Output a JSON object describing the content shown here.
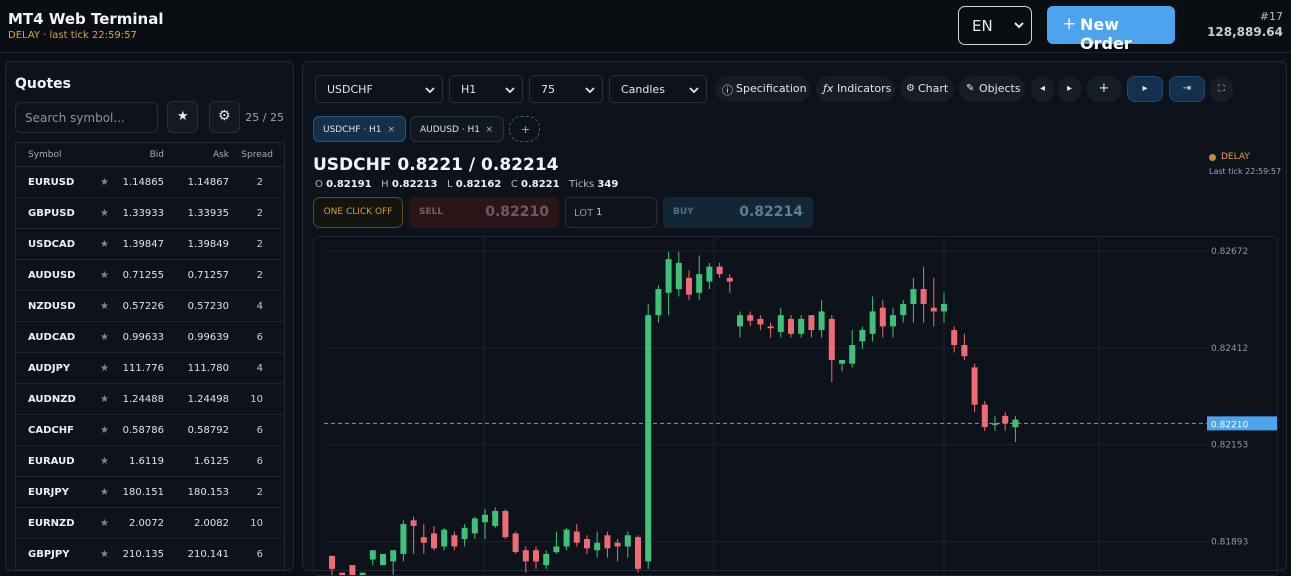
{
  "header": {
    "title": "MT4 Web Terminal",
    "subtitle": "DELAY · last tick 22:59:57",
    "language": "EN",
    "new_order_plus": "+",
    "new_order_label": "New Order",
    "account_id": "#17",
    "account_balance": "128,889.64"
  },
  "quotes": {
    "title": "Quotes",
    "search_placeholder": "Search symbol...",
    "star_glyph": "★",
    "gear_glyph": "⚙",
    "count": "25 / 25",
    "columns": {
      "symbol": "Symbol",
      "bid": "Bid",
      "ask": "Ask",
      "spread": "Spread"
    },
    "rows": [
      {
        "symbol": "EURUSD",
        "bid": "1.14865",
        "ask": "1.14867",
        "spread": "2"
      },
      {
        "symbol": "GBPUSD",
        "bid": "1.33933",
        "ask": "1.33935",
        "spread": "2"
      },
      {
        "symbol": "USDCAD",
        "bid": "1.39847",
        "ask": "1.39849",
        "spread": "2"
      },
      {
        "symbol": "AUDUSD",
        "bid": "0.71255",
        "ask": "0.71257",
        "spread": "2"
      },
      {
        "symbol": "NZDUSD",
        "bid": "0.57226",
        "ask": "0.57230",
        "spread": "4"
      },
      {
        "symbol": "AUDCAD",
        "bid": "0.99633",
        "ask": "0.99639",
        "spread": "6"
      },
      {
        "symbol": "AUDJPY",
        "bid": "111.776",
        "ask": "111.780",
        "spread": "4"
      },
      {
        "symbol": "AUDNZD",
        "bid": "1.24488",
        "ask": "1.24498",
        "spread": "10"
      },
      {
        "symbol": "CADCHF",
        "bid": "0.58786",
        "ask": "0.58792",
        "spread": "6"
      },
      {
        "symbol": "EURAUD",
        "bid": "1.6119",
        "ask": "1.6125",
        "spread": "6"
      },
      {
        "symbol": "EURJPY",
        "bid": "180.151",
        "ask": "180.153",
        "spread": "2"
      },
      {
        "symbol": "EURNZD",
        "bid": "2.0072",
        "ask": "2.0082",
        "spread": "10"
      },
      {
        "symbol": "GBPJPY",
        "bid": "210.135",
        "ask": "210.141",
        "spread": "6"
      }
    ]
  },
  "toolbar": {
    "symbol_select": "USDCHF",
    "timeframe_select": "H1",
    "bars_select": "75",
    "chart_type_select": "Candles",
    "specification": "Specification",
    "indicators": "Indicators",
    "chart": "Chart",
    "objects": "Objects",
    "spec_icon": "ⓘ",
    "ind_icon": "ƒx",
    "chart_icon": "⚙",
    "obj_icon": "✎",
    "prev_glyph": "◂",
    "next_glyph": "▸",
    "crosshair_glyph": "+",
    "play_glyph": "▸",
    "end_glyph": "⇥",
    "fullscreen_glyph": "⛶"
  },
  "tabs": [
    {
      "label": "USDCHF · H1",
      "active": true
    },
    {
      "label": "AUDUSD · H1",
      "active": false
    }
  ],
  "tab_close_glyph": "×",
  "add_tab_glyph": "+",
  "instrument": {
    "heading": "USDCHF 0.8221 / 0.82214",
    "open_label": "O",
    "open": "0.82191",
    "high_label": "H",
    "high": "0.82213",
    "low_label": "L",
    "low": "0.82162",
    "close_label": "C",
    "close": "0.8221",
    "ticks_label": "Ticks",
    "ticks": "349",
    "status": "DELAY",
    "last_tick": "Last tick 22:59:57"
  },
  "trade": {
    "one_click": "ONE CLICK OFF",
    "sell_label": "SELL",
    "sell_price": "0.82210",
    "lot_label": "LOT",
    "lot_value": "1",
    "buy_label": "BUY",
    "buy_price": "0.82214"
  },
  "colors": {
    "up": "#3ec27a",
    "down": "#ef6b73",
    "accent": "#4ea3ee",
    "delay": "#e3a04b"
  },
  "chart_data": {
    "type": "candlestick",
    "y_ticks": [
      "0.82672",
      "0.82412",
      "0.82153",
      "0.81893"
    ],
    "y_tick_values": [
      0.82672,
      0.82412,
      0.82153,
      0.81893
    ],
    "current_price_label": "0.82210",
    "current_price": 0.8221,
    "grid": true,
    "candles": [
      [
        0.8185,
        0.81855,
        0.8182,
        0.818
      ],
      [
        0.818,
        0.8181,
        0.8179,
        0.8178
      ],
      [
        0.8182,
        0.8183,
        0.8179,
        0.8178
      ],
      [
        0.818,
        0.8179,
        0.8181,
        0.8178
      ],
      [
        0.8185,
        0.81845,
        0.8187,
        0.8183
      ],
      [
        0.818,
        0.8183,
        0.8186,
        0.8178
      ],
      [
        0.8185,
        0.8184,
        0.8187,
        0.818
      ],
      [
        0.8195,
        0.8186,
        0.8194,
        0.8184
      ],
      [
        0.8196,
        0.8195,
        0.81935,
        0.8186
      ],
      [
        0.8194,
        0.81905,
        0.8189,
        0.8186
      ],
      [
        0.81935,
        0.81915,
        0.81875,
        0.8187
      ],
      [
        0.8193,
        0.8188,
        0.81925,
        0.8187
      ],
      [
        0.8192,
        0.8191,
        0.8188,
        0.8187
      ],
      [
        0.8194,
        0.819,
        0.8193,
        0.8188
      ],
      [
        0.8196,
        0.81915,
        0.81955,
        0.819
      ],
      [
        0.8198,
        0.81945,
        0.81965,
        0.819
      ],
      [
        0.81985,
        0.81935,
        0.81975,
        0.8193
      ],
      [
        0.8198,
        0.81975,
        0.81905,
        0.819
      ],
      [
        0.8192,
        0.81915,
        0.81865,
        0.8186
      ],
      [
        0.8188,
        0.8187,
        0.8184,
        0.8181
      ],
      [
        0.8188,
        0.8187,
        0.8184,
        0.8182
      ],
      [
        0.8187,
        0.8183,
        0.8186,
        0.8182
      ],
      [
        0.8192,
        0.81865,
        0.8188,
        0.8186
      ],
      [
        0.8193,
        0.8188,
        0.81925,
        0.8187
      ],
      [
        0.8194,
        0.8192,
        0.8189,
        0.8188
      ],
      [
        0.8191,
        0.819,
        0.81875,
        0.8186
      ],
      [
        0.8192,
        0.8187,
        0.8189,
        0.8185
      ],
      [
        0.8192,
        0.8191,
        0.81875,
        0.8185
      ],
      [
        0.819,
        0.8189,
        0.8188,
        0.8184
      ],
      [
        0.8192,
        0.8188,
        0.8191,
        0.8185
      ],
      [
        0.8191,
        0.81905,
        0.8182,
        0.8181
      ],
      [
        0.8253,
        0.8184,
        0.825,
        0.8182
      ],
      [
        0.8258,
        0.825,
        0.8257,
        0.8248
      ],
      [
        0.8267,
        0.8256,
        0.8265,
        0.825
      ],
      [
        0.8267,
        0.8257,
        0.8264,
        0.8255
      ],
      [
        0.8262,
        0.826,
        0.82555,
        0.8254
      ],
      [
        0.8266,
        0.8256,
        0.8261,
        0.8254
      ],
      [
        0.8264,
        0.8259,
        0.8263,
        0.8257
      ],
      [
        0.8264,
        0.8263,
        0.8261,
        0.826
      ],
      [
        0.8261,
        0.826,
        0.8259,
        0.8256
      ],
      [
        0.8251,
        0.8247,
        0.825,
        0.8244
      ],
      [
        0.8251,
        0.825,
        0.82485,
        0.8247
      ],
      [
        0.825,
        0.8249,
        0.82475,
        0.8246
      ],
      [
        0.8248,
        0.8247,
        0.82465,
        0.8244
      ],
      [
        0.8252,
        0.82455,
        0.825,
        0.8244
      ],
      [
        0.825,
        0.8249,
        0.8245,
        0.8244
      ],
      [
        0.825,
        0.8245,
        0.8249,
        0.8244
      ],
      [
        0.825,
        0.825,
        0.8246,
        0.8244
      ],
      [
        0.8254,
        0.8246,
        0.8251,
        0.8244
      ],
      [
        0.825,
        0.8249,
        0.8238,
        0.8232
      ],
      [
        0.8238,
        0.8237,
        0.8238,
        0.8235
      ],
      [
        0.8246,
        0.8237,
        0.8242,
        0.8236
      ],
      [
        0.8247,
        0.8243,
        0.8246,
        0.8241
      ],
      [
        0.8255,
        0.8245,
        0.8251,
        0.8243
      ],
      [
        0.8254,
        0.8252,
        0.8247,
        0.8244
      ],
      [
        0.8252,
        0.8247,
        0.825,
        0.8244
      ],
      [
        0.8254,
        0.825,
        0.8253,
        0.8248
      ],
      [
        0.826,
        0.8253,
        0.8257,
        0.8248
      ],
      [
        0.8263,
        0.8257,
        0.8253,
        0.8248
      ],
      [
        0.826,
        0.8252,
        0.8251,
        0.8247
      ],
      [
        0.8256,
        0.8251,
        0.8253,
        0.8248
      ],
      [
        0.8247,
        0.8246,
        0.8242,
        0.824
      ],
      [
        0.8245,
        0.8242,
        0.8239,
        0.8238
      ],
      [
        0.8237,
        0.8236,
        0.8226,
        0.8224
      ],
      [
        0.8227,
        0.8226,
        0.822,
        0.8219
      ],
      [
        0.8223,
        0.8221,
        0.8221,
        0.8219
      ],
      [
        0.8224,
        0.8223,
        0.8221,
        0.8219
      ],
      [
        0.8223,
        0.822,
        0.8222,
        0.8216
      ]
    ],
    "y_min": 0.8179,
    "y_max": 0.8275
  }
}
